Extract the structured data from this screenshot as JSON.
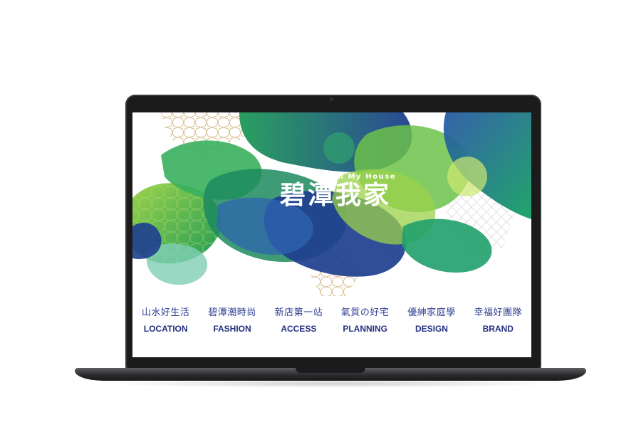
{
  "site": {
    "subtitle": "Bitan My House",
    "title": "碧潭我家"
  },
  "nav": {
    "items": [
      {
        "zh": "山水好生活",
        "en": "LOCATION"
      },
      {
        "zh": "碧潭潮時尚",
        "en": "FASHION"
      },
      {
        "zh": "新店第一站",
        "en": "ACCESS"
      },
      {
        "zh": "氣質の好宅",
        "en": "PLANNING"
      },
      {
        "zh": "優紳家庭學",
        "en": "DESIGN"
      },
      {
        "zh": "幸福好團隊",
        "en": "BRAND"
      }
    ]
  },
  "colors": {
    "nav_text": "#23307f",
    "green_light": "#8cc63f",
    "green": "#1f9a57",
    "teal": "#138a6e",
    "navy": "#1e3f8f",
    "gold_pattern": "#c9a86b",
    "frame": "#1b1b1c"
  }
}
